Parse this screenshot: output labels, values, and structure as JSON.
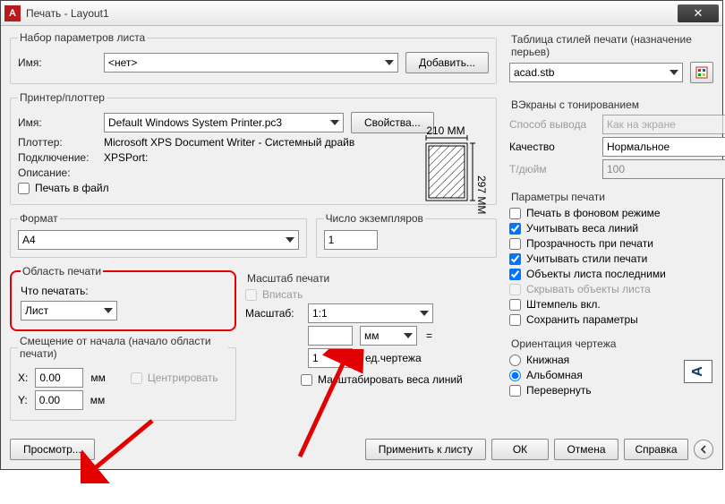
{
  "window": {
    "title": "Печать - Layout1",
    "close_icon": "✕"
  },
  "pageset": {
    "legend": "Набор параметров листа",
    "name_label": "Имя:",
    "name_value": "<нет>",
    "add_btn": "Добавить..."
  },
  "printer": {
    "legend": "Принтер/плоттер",
    "name_label": "Имя:",
    "name_value": "Default Windows System Printer.pc3",
    "props_btn": "Свойства...",
    "plotter_label": "Плоттер:",
    "plotter_value": "Microsoft XPS Document Writer - Системный драйв...",
    "port_label": "Подключение:",
    "port_value": "XPSPort:",
    "desc_label": "Описание:",
    "to_file": "Печать в файл",
    "dim_w": "210 MM",
    "dim_h": "297 MM"
  },
  "format": {
    "legend": "Формат",
    "value": "A4"
  },
  "copies": {
    "legend": "Число экземпляров",
    "value": "1"
  },
  "area": {
    "legend": "Область печати",
    "what_label": "Что печатать:",
    "value": "Лист"
  },
  "offset": {
    "legend": "Смещение от начала (начало области печати)",
    "x_label": "X:",
    "x_value": "0.00",
    "y_label": "Y:",
    "y_value": "0.00",
    "unit": "мм",
    "center": "Центрировать"
  },
  "scale": {
    "legend": "Масштаб печати",
    "fit": "Вписать",
    "label": "Масштаб:",
    "ratio": "1:1",
    "mm_value": "",
    "mm": "мм",
    "unit_value": "1",
    "unit_label": "ед.чертежа",
    "scale_lw": "Масштабировать веса линий"
  },
  "styles": {
    "legend": "Таблица стилей печати (назначение перьев)",
    "value": "acad.stb"
  },
  "vp": {
    "legend": "ВЭкраны с тонированием",
    "mode_label": "Способ вывода",
    "mode_value": "Как на экране",
    "quality_label": "Качество",
    "quality_value": "Нормальное",
    "dpi_label": "Т/дюйм",
    "dpi_value": "100"
  },
  "opts": {
    "legend": "Параметры печати",
    "bg": "Печать в фоновом режиме",
    "lw": "Учитывать веса линий",
    "tr": "Прозрачность при печати",
    "ps": "Учитывать стили печати",
    "pl": "Объекты листа последними",
    "hide": "Скрывать объекты листа",
    "stamp": "Штемпель вкл.",
    "save": "Сохранить параметры"
  },
  "orient": {
    "legend": "Ориентация чертежа",
    "portrait": "Книжная",
    "landscape": "Альбомная",
    "flip": "Перевернуть",
    "a": "A"
  },
  "footer": {
    "preview": "Просмотр...",
    "apply": "Применить к листу",
    "ok": "ОК",
    "cancel": "Отмена",
    "help": "Справка",
    "chev": "ⓘ"
  }
}
